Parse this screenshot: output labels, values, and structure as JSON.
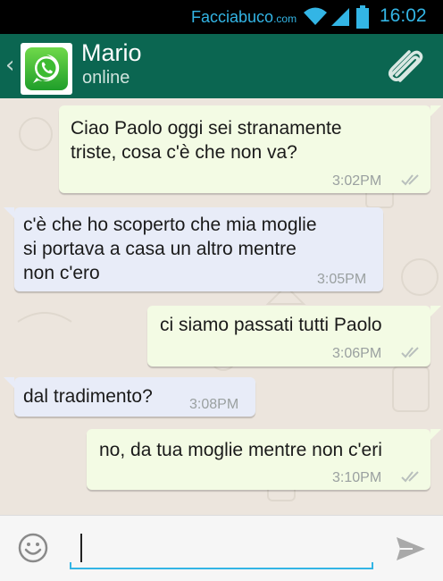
{
  "status_bar": {
    "watermark_main": "Facciabuco",
    "watermark_tld": ".com",
    "time": "16:02"
  },
  "header": {
    "contact_name": "Mario",
    "contact_status": "online",
    "icons": [
      "back-icon",
      "whatsapp-avatar-icon",
      "paperclip-icon"
    ]
  },
  "messages": [
    {
      "direction": "out",
      "text": "Ciao Paolo oggi sei stranamente\ntriste, cosa c'è che non va?",
      "time": "3:02PM"
    },
    {
      "direction": "in",
      "text": "c'è che ho scoperto che mia moglie\nsi portava a casa un altro mentre\nnon c'ero",
      "time": "3:05PM"
    },
    {
      "direction": "out",
      "text": "ci siamo passati tutti Paolo",
      "time": "3:06PM"
    },
    {
      "direction": "in",
      "text": "dal tradimento?",
      "time": "3:08PM"
    },
    {
      "direction": "out",
      "text": "no, da tua moglie mentre non c'eri",
      "time": "3:10PM"
    }
  ],
  "composer": {
    "value": "",
    "icons": [
      "emoji-icon",
      "send-icon"
    ]
  }
}
